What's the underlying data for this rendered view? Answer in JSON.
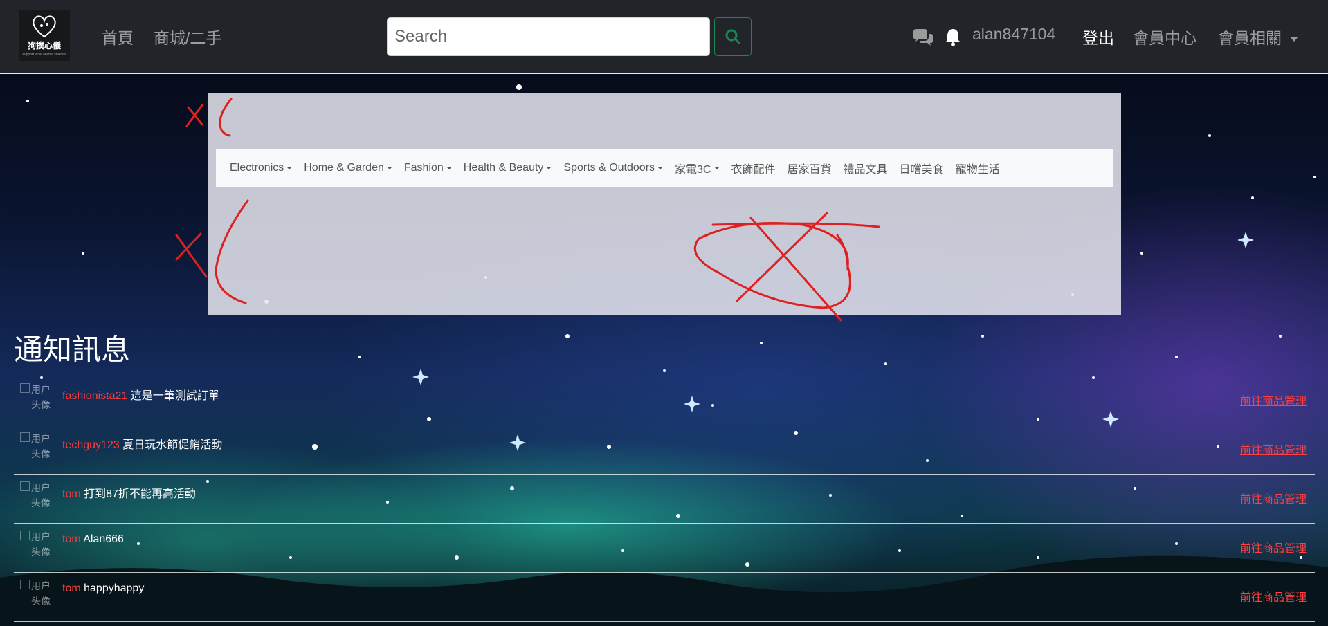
{
  "navbar": {
    "logo": {
      "brand": "狗撲心儀",
      "tagline": "support local animal shelters"
    },
    "links": [
      "首頁",
      "商城/二手"
    ],
    "search": {
      "placeholder": "Search",
      "value": ""
    },
    "username": "alan847104",
    "logout": "登出",
    "member_center": "會員中心",
    "member_menu": "會員相關"
  },
  "categories": [
    {
      "label": "Electronics",
      "dropdown": true
    },
    {
      "label": "Home & Garden",
      "dropdown": true
    },
    {
      "label": "Fashion",
      "dropdown": true
    },
    {
      "label": "Health & Beauty",
      "dropdown": true
    },
    {
      "label": "Sports & Outdoors",
      "dropdown": true
    },
    {
      "label": "家電3C",
      "dropdown": true
    },
    {
      "label": "衣飾配件",
      "dropdown": false
    },
    {
      "label": "居家百貨",
      "dropdown": false
    },
    {
      "label": "禮品文具",
      "dropdown": false
    },
    {
      "label": "日嚐美食",
      "dropdown": false
    },
    {
      "label": "寵物生活",
      "dropdown": false
    }
  ],
  "notifications": {
    "title": "通知訊息",
    "items": [
      {
        "user": "fashionista21",
        "message": "這是一筆測試訂單",
        "avatar_alt": "用户头像",
        "link": "前往商品管理"
      },
      {
        "user": "techguy123",
        "message": "夏日玩水節促銷活動",
        "avatar_alt": "用户头像",
        "link": "前往商品管理"
      },
      {
        "user": "tom",
        "message": "打到87折不能再高活動",
        "avatar_alt": "用户头像",
        "link": "前往商品管理"
      },
      {
        "user": "tom",
        "message": "Alan666",
        "avatar_alt": "用户头像",
        "link": "前往商品管理"
      },
      {
        "user": "tom",
        "message": "happyhappy",
        "avatar_alt": "用户头像",
        "link": "前往商品管理"
      }
    ]
  },
  "colors": {
    "navbar_bg": "#212529",
    "accent_red": "#ff4040",
    "search_button": "#198754",
    "panel_bg": "#e6e6f0",
    "scribble": "#e02020"
  },
  "icons": [
    "chat-icon",
    "bell-icon",
    "search-icon",
    "caret-down-icon"
  ]
}
